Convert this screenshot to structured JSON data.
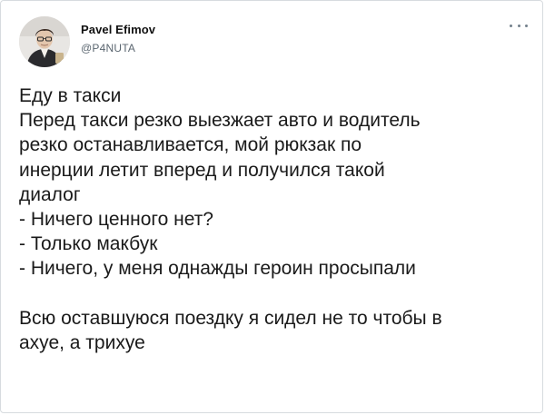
{
  "author": {
    "name": "Pavel Efimov",
    "handle": "@P4NUTA",
    "avatar_icon": "user-avatar-photo"
  },
  "menu": {
    "icon": "more-options-icon"
  },
  "tweet": {
    "lines": [
      "Еду в такси",
      "Перед такси резко выезжает авто и водитель",
      "резко останавливается, мой рюкзак по",
      "инерции летит вперед и получился такой",
      "диалог",
      "- Ничего ценного нет?",
      "- Только макбук",
      "- Ничего, у меня однажды героин просыпали"
    ],
    "closing_lines": [
      "Всю оставшуюся поездку я сидел не то чтобы в",
      "ахуе, а трихуе"
    ]
  },
  "colors": {
    "border": "#d7dbdf",
    "text": "#1a1a1a",
    "muted": "#5b6670"
  }
}
